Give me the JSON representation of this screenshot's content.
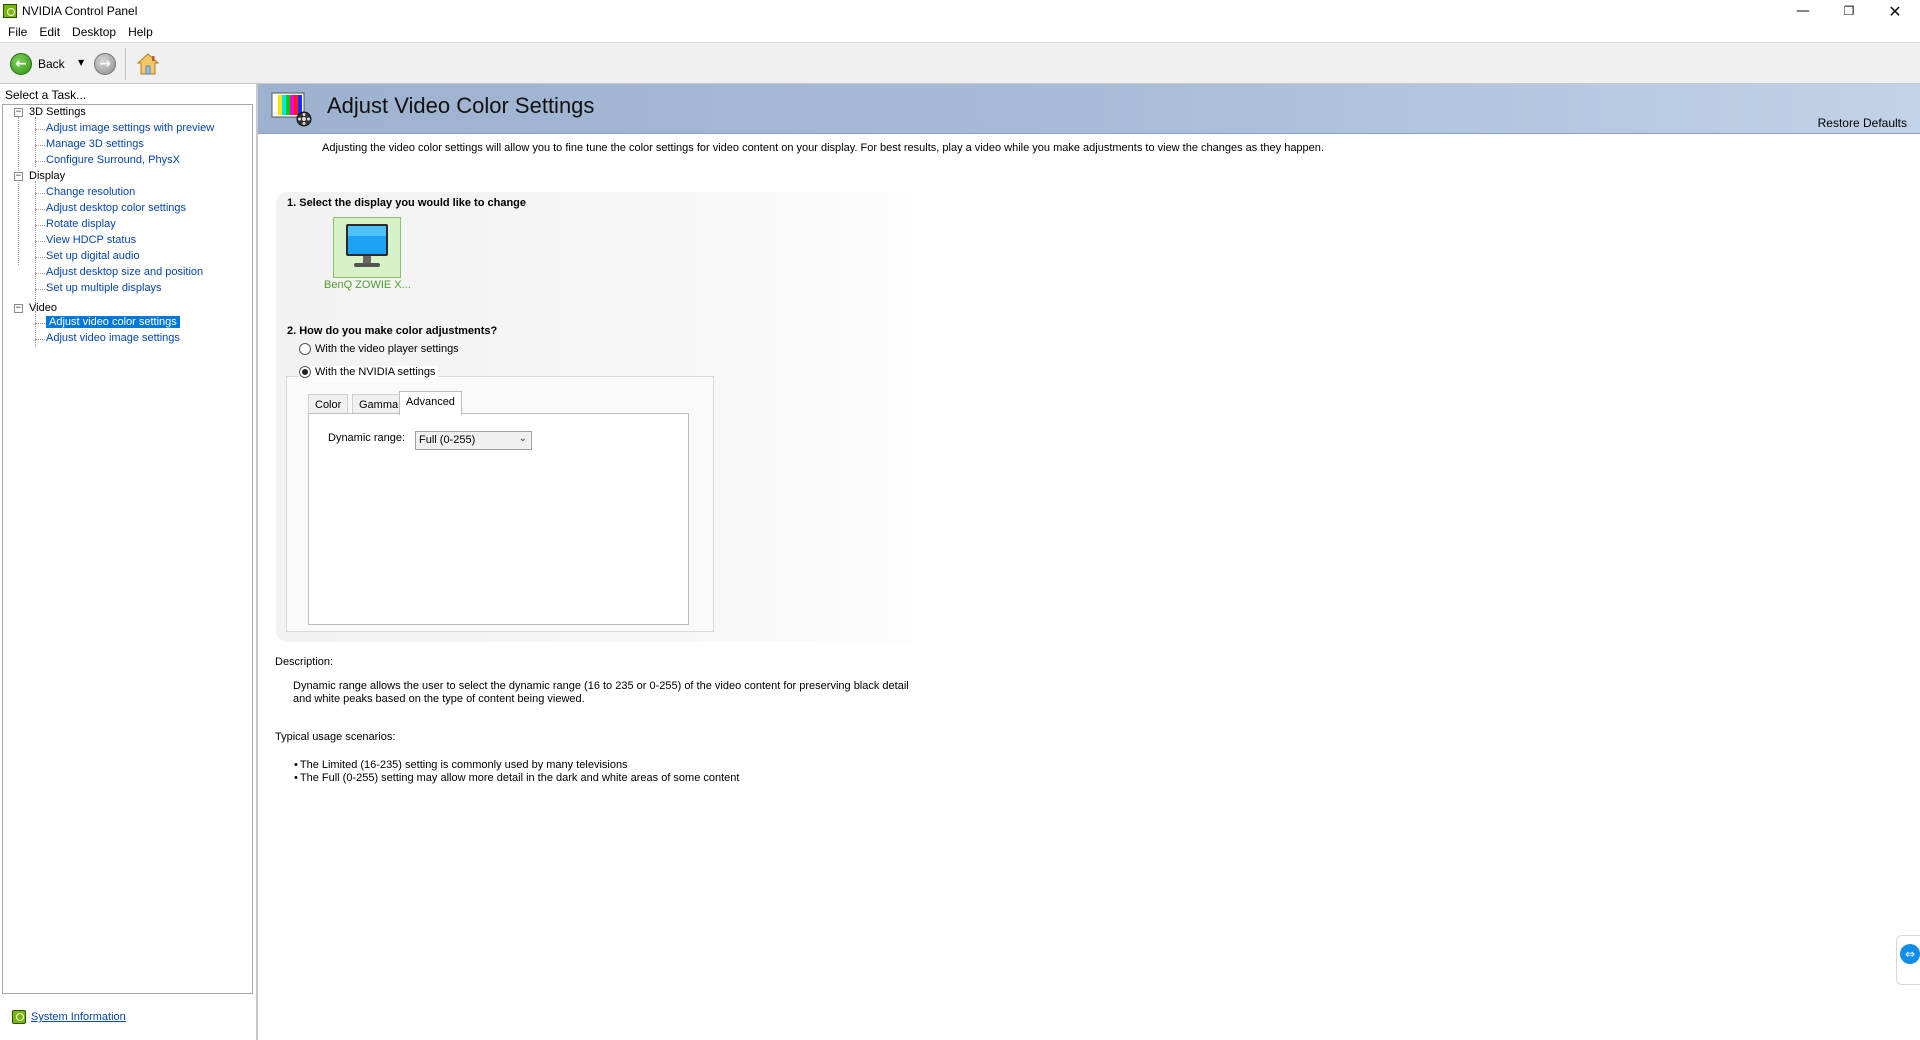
{
  "window": {
    "title": "NVIDIA Control Panel",
    "min_glyph": "—",
    "max_glyph": "❐",
    "close_glyph": "✕"
  },
  "menu": [
    "File",
    "Edit",
    "Desktop",
    "Help"
  ],
  "toolbar": {
    "back_label": "Back",
    "back_icon": "←",
    "dropdown_glyph": "▼",
    "forward_icon": "→"
  },
  "tasks": {
    "label": "Select a Task...",
    "tree": {
      "cat1": "3D Settings",
      "cat1_items": [
        "Adjust image settings with preview",
        "Manage 3D settings",
        "Configure Surround, PhysX"
      ],
      "cat2": "Display",
      "cat2_items": [
        "Change resolution",
        "Adjust desktop color settings",
        "Rotate display",
        "View HDCP status",
        "Set up digital audio",
        "Adjust desktop size and position",
        "Set up multiple displays"
      ],
      "cat3": "Video",
      "cat3_items": [
        "Adjust video color settings",
        "Adjust video image settings"
      ],
      "expander_glyph": "−"
    },
    "system_information": "System Information"
  },
  "page": {
    "title": "Adjust Video Color Settings",
    "restore_defaults": "Restore Defaults",
    "intro": "Adjusting the video color settings will allow you to fine tune the color settings for video content on your display. For best results, play a video while you make adjustments to view the changes as they happen.",
    "section1": "1. Select the display you would like to change",
    "display_name": "BenQ ZOWIE X...",
    "section2": "2. How do you make color adjustments?",
    "radio_player": "With the video player settings",
    "radio_nvidia": "With the NVIDIA settings",
    "radio_selected": "nvidia",
    "tabs": [
      "Color",
      "Gamma",
      "Advanced"
    ],
    "active_tab": "Advanced",
    "dynamic_range_label": "Dynamic range:",
    "dynamic_range_value": "Full (0-255)",
    "chevron_glyph": "⌄",
    "description_heading": "Description:",
    "description_line1": "Dynamic range allows the user to select the dynamic range (16 to 235 or 0-255) of the video content for preserving black detail",
    "description_line2": "and white peaks based on the type of content being viewed.",
    "usage_heading": "Typical usage scenarios:",
    "usage_items": [
      "The Limited (16-235) setting is commonly used by many televisions",
      "The Full (0-255) setting may allow more detail in the dark and white areas of some content"
    ]
  },
  "remote_glyph": "⇔",
  "colors": {
    "nvidia_green": "#76b900",
    "link_blue": "#0645ad",
    "selection_blue": "#0078d7",
    "banner_blue": "#a7bcd8"
  }
}
